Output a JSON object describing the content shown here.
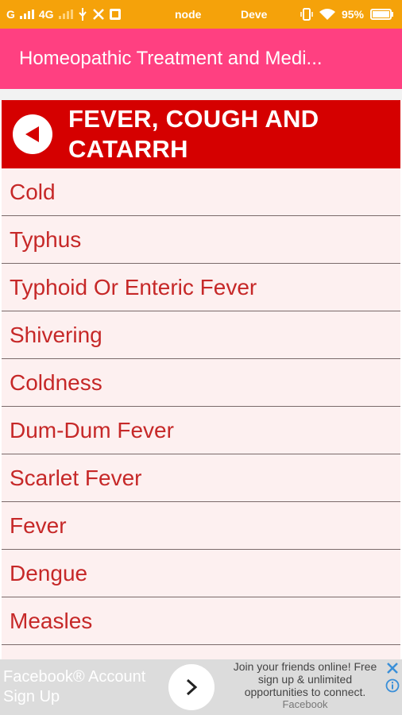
{
  "status_bar": {
    "carrier": "G",
    "network": "4G",
    "mode_text": "node",
    "dev_text": "Deve",
    "battery": "95%"
  },
  "app_bar": {
    "title": "Homeopathic Treatment and Medi..."
  },
  "category": {
    "title": "FEVER, COUGH AND CATARRH",
    "back_icon": "back-arrow-icon"
  },
  "items": [
    {
      "label": "Cold"
    },
    {
      "label": "Typhus"
    },
    {
      "label": "Typhoid Or Enteric Fever"
    },
    {
      "label": "Shivering"
    },
    {
      "label": "Coldness"
    },
    {
      "label": "Dum-Dum Fever"
    },
    {
      "label": "Scarlet Fever"
    },
    {
      "label": "Fever"
    },
    {
      "label": "Dengue"
    },
    {
      "label": "Measles"
    }
  ],
  "ad": {
    "left_line1": "Facebook® Account",
    "left_line2": "Sign Up",
    "right_line1": "Join your friends online! Free",
    "right_line2": "sign up & unlimited",
    "right_line3": "opportunities to connect.",
    "sponsor": "Facebook"
  },
  "colors": {
    "status_bar": "#f5a20a",
    "app_bar": "#ff4081",
    "category_header": "#d50000",
    "item_text": "#c62828",
    "list_bg": "#fdf0f0"
  }
}
